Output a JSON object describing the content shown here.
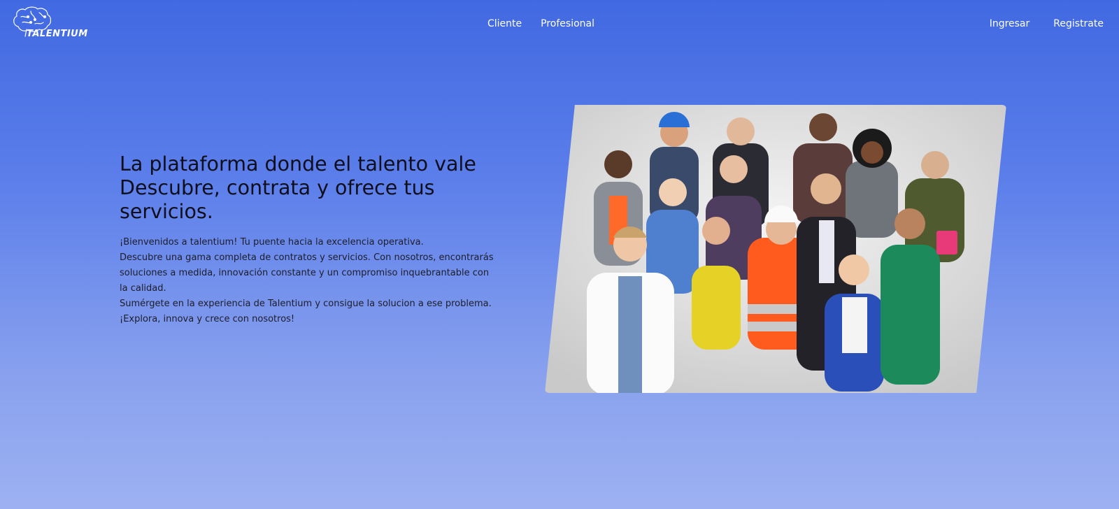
{
  "brand": {
    "name": "TALENTIUM",
    "logo_icon": "brain-icon"
  },
  "nav": {
    "center": [
      {
        "label": "Cliente"
      },
      {
        "label": "Profesional"
      }
    ],
    "right": [
      {
        "label": "Ingresar"
      },
      {
        "label": "Registrate"
      }
    ]
  },
  "hero": {
    "title_lines": [
      "La plataforma donde el talento vale",
      "Descubre, contrata y ofrece tus",
      "servicios."
    ],
    "description_lines": [
      "¡Bienvenidos a talentium! Tu puente hacia la excelencia operativa.",
      "Descubre una gama completa de contratos y servicios. Con nosotros, encontrarás",
      "soluciones a medida, innovación constante y un compromiso inquebrantable con",
      "la calidad.",
      "Sumérgete en la experiencia de Talentium y consigue la solucion a ese problema.",
      "¡Explora, innova y crece con nosotros!"
    ],
    "image_subject": "group-of-diverse-professionals-photo"
  },
  "colors": {
    "gradient_top": "#4169e1",
    "gradient_bottom": "#9db1f2",
    "nav_text": "#ffffff",
    "heading_text": "#0e0e1c"
  }
}
